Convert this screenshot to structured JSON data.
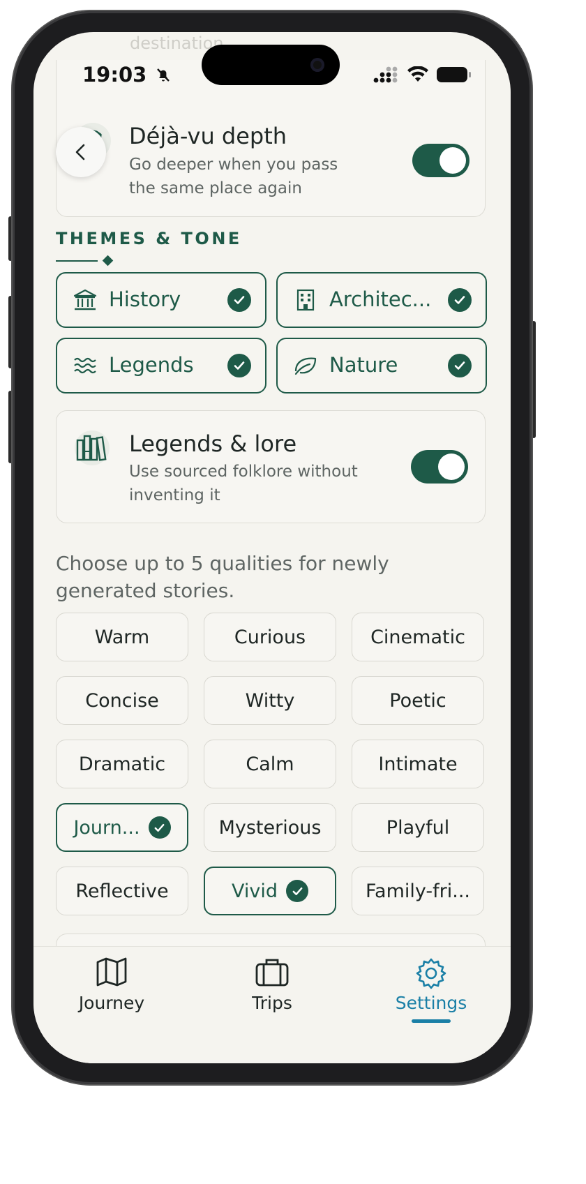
{
  "status": {
    "time": "19:03"
  },
  "ghost_text": "destination",
  "deja_vu": {
    "title": "Déjà-vu depth",
    "subtitle_line1": "Go deeper when you pass",
    "subtitle_line2": "the same place again",
    "enabled": true
  },
  "themes_section": {
    "title": "THEMES & TONE",
    "themes": [
      {
        "label": "History",
        "icon": "museum-icon",
        "selected": true
      },
      {
        "label": "Architec...",
        "icon": "building-icon",
        "selected": true
      },
      {
        "label": "Legends",
        "icon": "waves-icon",
        "selected": true
      },
      {
        "label": "Nature",
        "icon": "leaf-icon",
        "selected": true
      }
    ]
  },
  "legends_lore": {
    "title": "Legends & lore",
    "subtitle_line1": "Use sourced folklore without",
    "subtitle_line2": "inventing it",
    "enabled": true
  },
  "qualities": {
    "hint": "Choose up to 5 qualities for newly generated stories.",
    "chips": [
      {
        "label": "Warm",
        "selected": false
      },
      {
        "label": "Curious",
        "selected": false
      },
      {
        "label": "Cinematic",
        "selected": false
      },
      {
        "label": "Concise",
        "selected": false
      },
      {
        "label": "Witty",
        "selected": false
      },
      {
        "label": "Poetic",
        "selected": false
      },
      {
        "label": "Dramatic",
        "selected": false
      },
      {
        "label": "Calm",
        "selected": false
      },
      {
        "label": "Intimate",
        "selected": false
      },
      {
        "label": "Journ...",
        "selected": true
      },
      {
        "label": "Mysterious",
        "selected": false
      },
      {
        "label": "Playful",
        "selected": false
      },
      {
        "label": "Reflective",
        "selected": false
      },
      {
        "label": "Vivid",
        "selected": true
      },
      {
        "label": "Family-fri...",
        "selected": false
      }
    ]
  },
  "tabbar": {
    "tabs": [
      {
        "label": "Journey",
        "icon": "map-icon",
        "active": false
      },
      {
        "label": "Trips",
        "icon": "suitcase-icon",
        "active": false
      },
      {
        "label": "Settings",
        "icon": "gear-icon",
        "active": true
      }
    ]
  },
  "colors": {
    "accent": "#1e5a48",
    "tab_active": "#1a7fa6",
    "background": "#f5f4ef"
  }
}
